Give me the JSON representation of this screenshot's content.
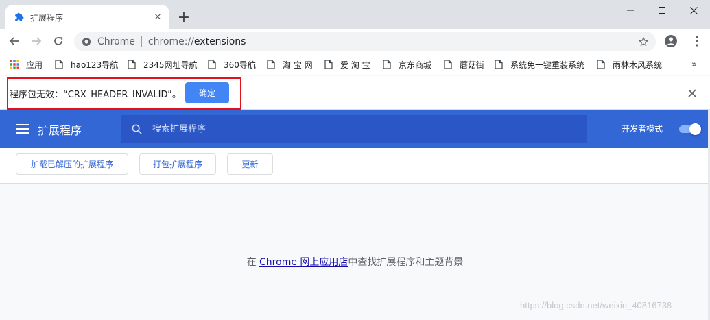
{
  "tab": {
    "title": "扩展程序",
    "close_glyph": "✕",
    "icon": "puzzle-icon"
  },
  "newtab_glyph": "+",
  "window_controls": {
    "minimize": "minimize-icon",
    "maximize": "maximize-icon",
    "close": "window-close-icon"
  },
  "omnibox": {
    "chip_label": "Chrome",
    "url_scheme": "chrome://",
    "url_host": "extensions",
    "secure_icon": "chrome-secure-icon"
  },
  "bookmarks": {
    "items": [
      {
        "label": "应用",
        "icon": "apps-grid-icon"
      },
      {
        "label": "hao123导航",
        "icon": "page-icon"
      },
      {
        "label": "2345网址导航",
        "icon": "page-icon"
      },
      {
        "label": "360导航",
        "icon": "page-icon"
      },
      {
        "label": "淘 宝 网",
        "icon": "page-icon"
      },
      {
        "label": "爱 淘 宝",
        "icon": "page-icon"
      },
      {
        "label": "京东商城",
        "icon": "page-icon"
      },
      {
        "label": "蘑菇街",
        "icon": "page-icon"
      },
      {
        "label": "系统免一键重装系统",
        "icon": "page-icon"
      },
      {
        "label": "雨林木风系统",
        "icon": "page-icon"
      }
    ],
    "more_glyph": "»"
  },
  "infobar": {
    "message": "程序包无效：“CRX_HEADER_INVALID”。",
    "ok_label": "确定"
  },
  "extensions": {
    "title": "扩展程序",
    "search_placeholder": "搜索扩展程序",
    "devmode_label": "开发者模式",
    "devmode_on": true,
    "actions": {
      "load_unpacked": "加载已解压的扩展程序",
      "pack": "打包扩展程序",
      "update": "更新"
    }
  },
  "empty_state": {
    "prefix": "在 ",
    "link": "Chrome 网上应用店",
    "suffix": "中查找扩展程序和主题背景"
  },
  "watermark": "https://blog.csdn.net/weixin_40816738",
  "colors": {
    "header_bg": "#3367d6",
    "search_bg": "#2a56c6",
    "primary_button": "#4285f4",
    "highlight_border": "#e3101a",
    "link": "#1a0dab"
  }
}
